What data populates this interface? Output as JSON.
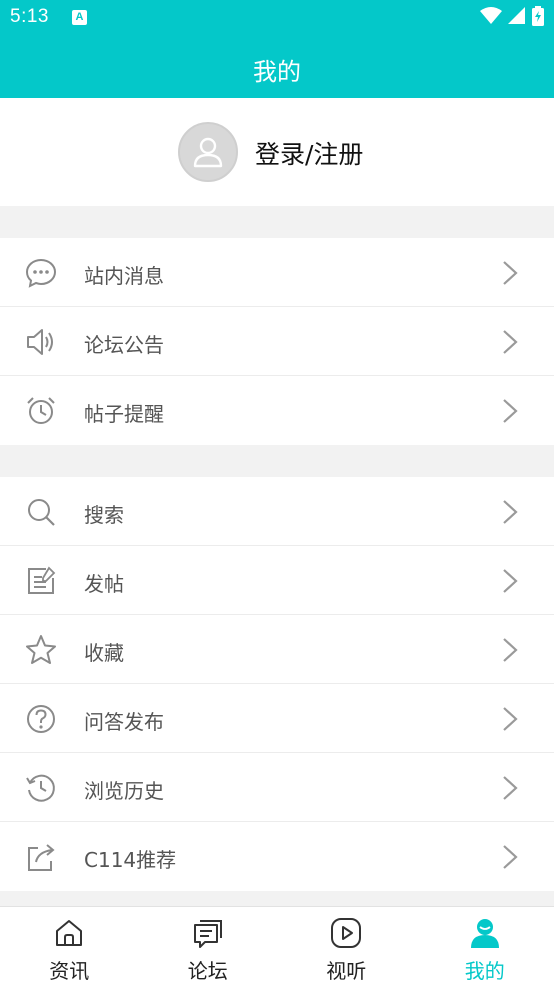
{
  "status_bar": {
    "time": "5:13",
    "notification_glyph": "A",
    "icons": [
      "wifi-icon",
      "signal-icon",
      "battery-icon"
    ]
  },
  "header": {
    "title": "我的"
  },
  "profile": {
    "login_label": "登录/注册",
    "avatar_icon": "user-avatar-icon"
  },
  "menu": {
    "group1": [
      {
        "label": "站内消息",
        "icon": "chat-bubble-icon"
      },
      {
        "label": "论坛公告",
        "icon": "speaker-icon"
      },
      {
        "label": "帖子提醒",
        "icon": "alarm-clock-icon"
      }
    ],
    "group2": [
      {
        "label": "搜索",
        "icon": "search-icon"
      },
      {
        "label": "发帖",
        "icon": "edit-post-icon"
      },
      {
        "label": "收藏",
        "icon": "star-icon"
      },
      {
        "label": "问答发布",
        "icon": "question-icon"
      },
      {
        "label": "浏览历史",
        "icon": "history-icon"
      },
      {
        "label": "C114推荐",
        "icon": "share-icon"
      }
    ]
  },
  "tabs": [
    {
      "label": "资讯",
      "icon": "home-icon",
      "active": false
    },
    {
      "label": "论坛",
      "icon": "forum-icon",
      "active": false
    },
    {
      "label": "视听",
      "icon": "play-icon",
      "active": false
    },
    {
      "label": "我的",
      "icon": "user-icon",
      "active": true
    }
  ],
  "colors": {
    "accent": "#04c8c9",
    "icon_gray": "#8a8a8a",
    "chevron_gray": "#9a9a9a"
  }
}
